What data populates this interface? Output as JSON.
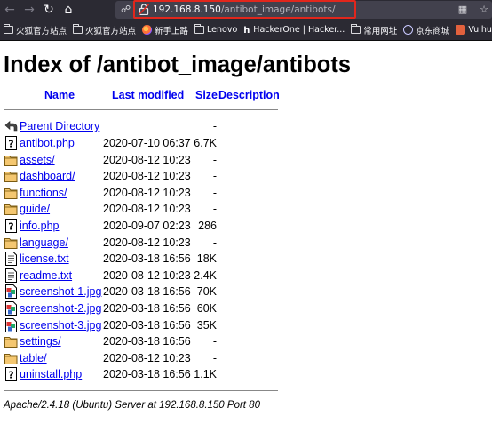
{
  "browser": {
    "url_host": "192.168.8.150",
    "url_path": "/antibot_image/antibots/",
    "bookmarks": [
      {
        "label": "火狐官方站点",
        "icon": "folder-icon"
      },
      {
        "label": "火狐官方站点",
        "icon": "folder-icon"
      },
      {
        "label": "新手上路",
        "icon": "firefox-icon"
      },
      {
        "label": "Lenovo",
        "icon": "folder-icon"
      },
      {
        "label": "HackerOne | Hacker...",
        "icon": "hackerone-icon"
      },
      {
        "label": "常用网址",
        "icon": "folder-icon"
      },
      {
        "label": "京东商城",
        "icon": "globe-icon"
      },
      {
        "label": "Vulhub - I",
        "icon": "vulhub-icon"
      }
    ]
  },
  "page": {
    "title": "Index of /antibot_image/antibots",
    "columns": {
      "name": "Name",
      "last_modified": "Last modified",
      "size": "Size",
      "description": "Description"
    },
    "parent": {
      "name": "Parent Directory",
      "last_modified": "",
      "size": "-"
    },
    "entries": [
      {
        "name": "antibot.php",
        "last_modified": "2020-07-10 06:37",
        "size": "6.7K",
        "icon": "unknown-file-icon"
      },
      {
        "name": "assets/",
        "last_modified": "2020-08-12 10:23",
        "size": "-",
        "icon": "folder-icon"
      },
      {
        "name": "dashboard/",
        "last_modified": "2020-08-12 10:23",
        "size": "-",
        "icon": "folder-icon"
      },
      {
        "name": "functions/",
        "last_modified": "2020-08-12 10:23",
        "size": "-",
        "icon": "folder-icon"
      },
      {
        "name": "guide/",
        "last_modified": "2020-08-12 10:23",
        "size": "-",
        "icon": "folder-icon"
      },
      {
        "name": "info.php",
        "last_modified": "2020-09-07 02:23",
        "size": "286",
        "icon": "unknown-file-icon"
      },
      {
        "name": "language/",
        "last_modified": "2020-08-12 10:23",
        "size": "-",
        "icon": "folder-icon"
      },
      {
        "name": "license.txt",
        "last_modified": "2020-03-18 16:56",
        "size": "18K",
        "icon": "text-file-icon"
      },
      {
        "name": "readme.txt",
        "last_modified": "2020-08-12 10:23",
        "size": "2.4K",
        "icon": "text-file-icon"
      },
      {
        "name": "screenshot-1.jpg",
        "last_modified": "2020-03-18 16:56",
        "size": "70K",
        "icon": "image-file-icon"
      },
      {
        "name": "screenshot-2.jpg",
        "last_modified": "2020-03-18 16:56",
        "size": "60K",
        "icon": "image-file-icon"
      },
      {
        "name": "screenshot-3.jpg",
        "last_modified": "2020-03-18 16:56",
        "size": "35K",
        "icon": "image-file-icon"
      },
      {
        "name": "settings/",
        "last_modified": "2020-03-18 16:56",
        "size": "-",
        "icon": "folder-icon"
      },
      {
        "name": "table/",
        "last_modified": "2020-08-12 10:23",
        "size": "-",
        "icon": "folder-icon"
      },
      {
        "name": "uninstall.php",
        "last_modified": "2020-03-18 16:56",
        "size": "1.1K",
        "icon": "unknown-file-icon"
      }
    ],
    "footer": "Apache/2.4.18 (Ubuntu) Server at 192.168.8.150 Port 80"
  },
  "colors": {
    "link": "#0000ee",
    "url_highlight": "#e1261c",
    "chrome": "#2b2a33"
  }
}
